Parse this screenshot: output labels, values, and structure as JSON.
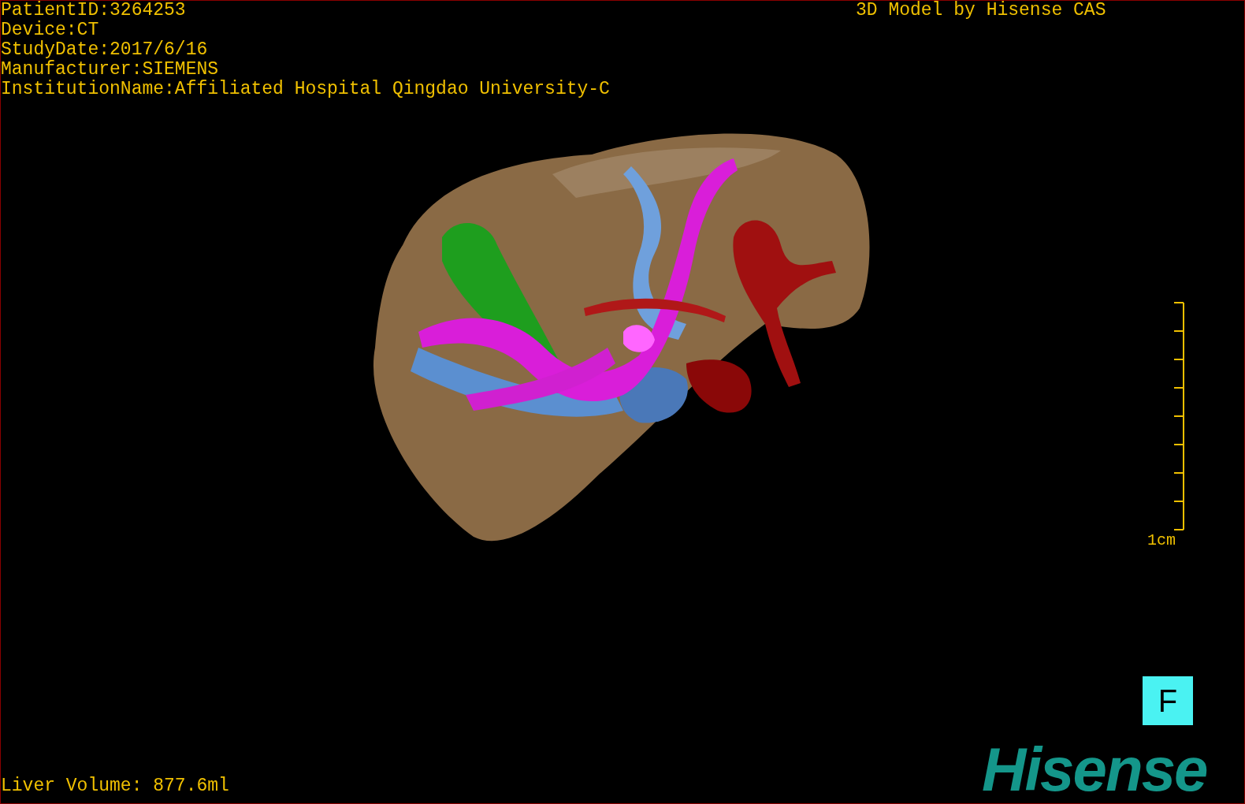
{
  "patient_info": [
    "PatientID:3264253",
    "Device:CT",
    "StudyDate:2017/6/16",
    "Manufacturer:SIEMENS",
    "InstitutionName:Affiliated Hospital Qingdao University-C"
  ],
  "title": "3D Model by Hisense CAS",
  "scale_label": "1cm",
  "orientation": "F",
  "logo": "Hisense",
  "volume": "Liver Volume: 877.6ml"
}
